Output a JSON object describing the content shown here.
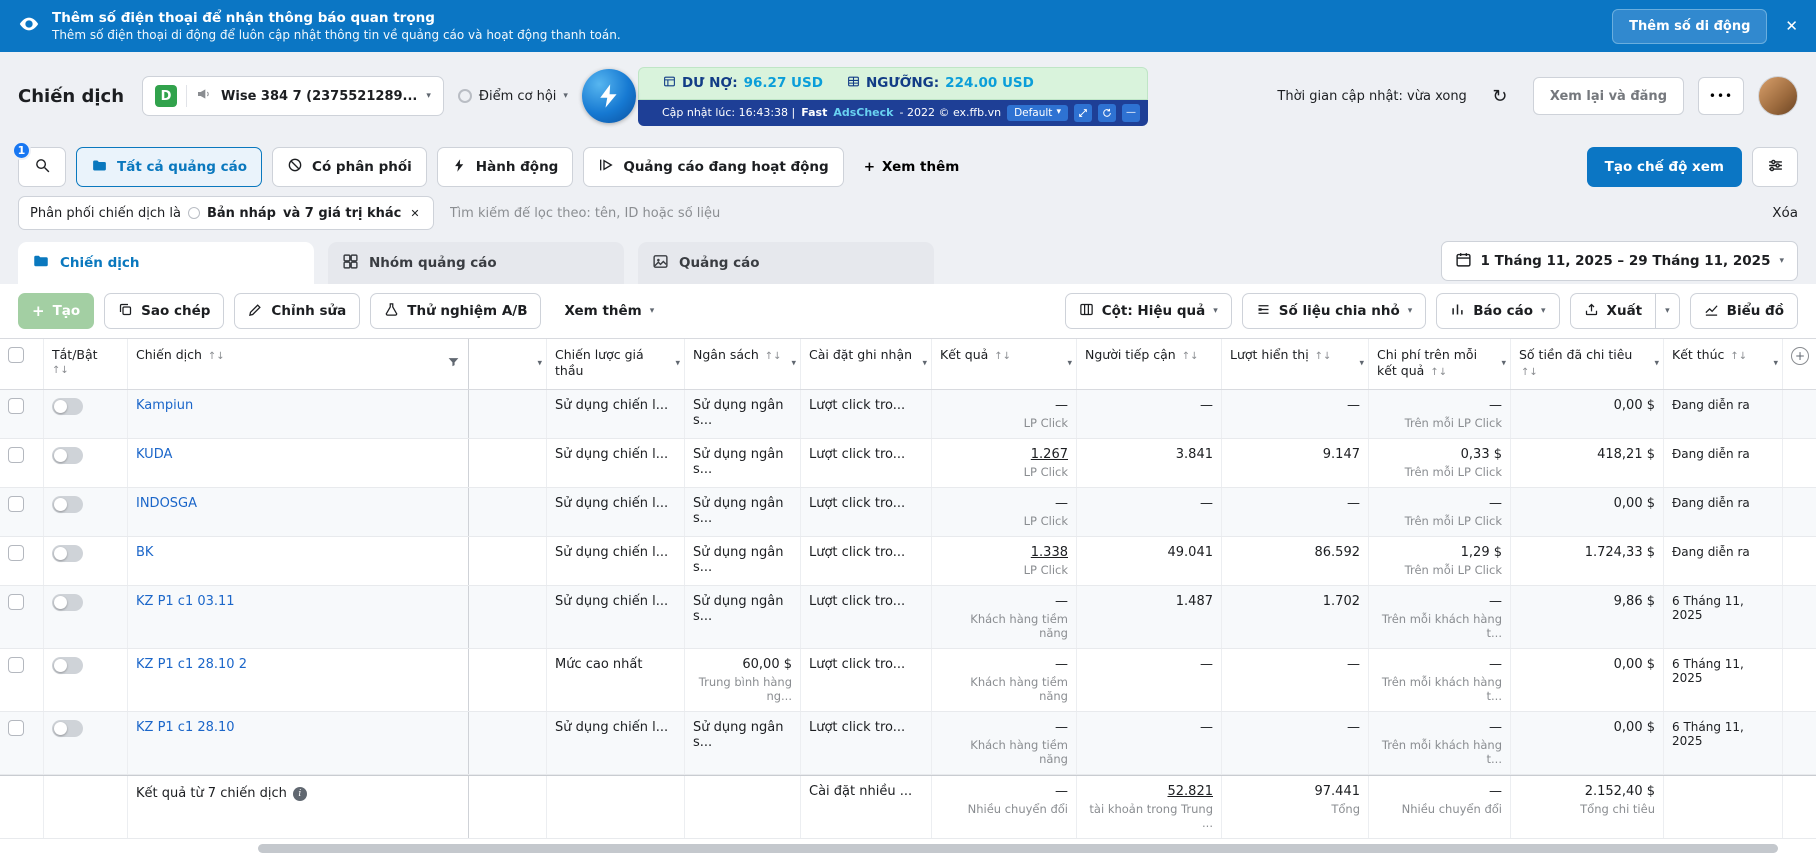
{
  "icons": {
    "sort": "↑↓",
    "caret": "▾",
    "close": "✕",
    "plus": "+",
    "more_dots": "•••",
    "refresh": "↻",
    "minimize": "—",
    "info": "i",
    "add": "+"
  },
  "banner": {
    "title": "Thêm số điện thoại để nhận thông báo quan trọng",
    "subtitle": "Thêm số điện thoại di động để luôn cập nhật thông tin về quảng cáo và hoạt động thanh toán.",
    "cta": "Thêm số di động"
  },
  "header": {
    "page_title": "Chiến dịch",
    "account_badge": "D",
    "account_name": "Wise 384 7 (2375521289...",
    "opportunity_label": "Điểm cơ hội",
    "balance": {
      "debt_label": "DƯ NỢ:",
      "debt_value": "96.27 USD",
      "threshold_label": "NGƯỠNG:",
      "threshold_value": "224.00 USD"
    },
    "adscheck": {
      "updated": "Cập nhật lúc: 16:43:38 |",
      "brand": "Fast",
      "product": "AdsCheck",
      "suffix": "- 2022 © ex.ffb.vn",
      "preset": "Default"
    },
    "refresh_status": "Thời gian cập nhật: vừa xong",
    "review_button": "Xem lại và đăng"
  },
  "filter_bar": {
    "search_badge": "1",
    "views": [
      "Tất cả quảng cáo",
      "Có phân phối",
      "Hành động",
      "Quảng cáo đang hoạt động"
    ],
    "more_label": "Xem thêm",
    "create_view_button": "Tạo chế độ xem"
  },
  "filter_chip": {
    "prefix": "Phân phối chiến dịch là",
    "value": "Bản nháp",
    "extra": "và 7 giá trị khác",
    "search_placeholder": "Tìm kiếm để lọc theo: tên, ID hoặc số liệu",
    "clear_label": "Xóa"
  },
  "tabs": {
    "campaigns": "Chiến dịch",
    "ad_sets": "Nhóm quảng cáo",
    "ads": "Quảng cáo",
    "date_range": "1 Tháng 11, 2025 – 29 Tháng 11, 2025"
  },
  "toolbar": {
    "create": "Tạo",
    "duplicate": "Sao chép",
    "edit": "Chỉnh sửa",
    "ab_test": "Thử nghiệm A/B",
    "more": "Xem thêm",
    "columns": "Cột: Hiệu quả",
    "breakdown": "Số liệu chia nhỏ",
    "reports": "Báo cáo",
    "export": "Xuất",
    "charts": "Biểu đồ"
  },
  "table": {
    "headers": {
      "toggle": "Tắt/Bật",
      "campaign": "Chiến dịch",
      "bid_strategy": "Chiến lược giá thầu",
      "budget": "Ngân sách",
      "attribution": "Cài đặt ghi nhận",
      "results": "Kết quả",
      "reach": "Người tiếp cận",
      "impressions": "Lượt hiển thị",
      "cost_per_result": "Chi phí trên mỗi kết quả",
      "amount_spent": "Số tiền đã chi tiêu",
      "ends": "Kết thúc"
    },
    "rows": [
      {
        "name": "Kampiun",
        "bid": "Sử dụng chiến l...",
        "budget": "Sử dụng ngân s...",
        "budget_sub": "",
        "attribution": "Lượt click tro...",
        "result": "—",
        "result_sub": "LP Click",
        "result_link": false,
        "reach": "—",
        "impressions": "—",
        "cost": "—",
        "cost_sub": "Trên mỗi LP Click",
        "spent": "0,00 $",
        "end": "Đang diễn ra"
      },
      {
        "name": "KUDA",
        "bid": "Sử dụng chiến l...",
        "budget": "Sử dụng ngân s...",
        "budget_sub": "",
        "attribution": "Lượt click tro...",
        "result": "1.267",
        "result_sub": "LP Click",
        "result_link": true,
        "reach": "3.841",
        "impressions": "9.147",
        "cost": "0,33 $",
        "cost_sub": "Trên mỗi LP Click",
        "spent": "418,21 $",
        "end": "Đang diễn ra"
      },
      {
        "name": "INDOSGA",
        "bid": "Sử dụng chiến l...",
        "budget": "Sử dụng ngân s...",
        "budget_sub": "",
        "attribution": "Lượt click tro...",
        "result": "—",
        "result_sub": "LP Click",
        "result_link": false,
        "reach": "—",
        "impressions": "—",
        "cost": "—",
        "cost_sub": "Trên mỗi LP Click",
        "spent": "0,00 $",
        "end": "Đang diễn ra"
      },
      {
        "name": "BK",
        "bid": "Sử dụng chiến l...",
        "budget": "Sử dụng ngân s...",
        "budget_sub": "",
        "attribution": "Lượt click tro...",
        "result": "1.338",
        "result_sub": "LP Click",
        "result_link": true,
        "reach": "49.041",
        "impressions": "86.592",
        "cost": "1,29 $",
        "cost_sub": "Trên mỗi LP Click",
        "spent": "1.724,33 $",
        "end": "Đang diễn ra"
      },
      {
        "name": "KZ P1 c1 03.11",
        "bid": "Sử dụng chiến l...",
        "budget": "Sử dụng ngân s...",
        "budget_sub": "",
        "attribution": "Lượt click tro...",
        "result": "—",
        "result_sub": "Khách hàng tiềm năng",
        "result_link": false,
        "reach": "1.487",
        "impressions": "1.702",
        "cost": "—",
        "cost_sub": "Trên mỗi khách hàng t...",
        "spent": "9,86 $",
        "end": "6 Tháng 11, 2025"
      },
      {
        "name": "KZ P1 c1 28.10 2",
        "bid": "Mức cao nhất",
        "budget": "60,00 $",
        "budget_sub": "Trung bình hàng ng...",
        "attribution": "Lượt click tro...",
        "result": "—",
        "result_sub": "Khách hàng tiềm năng",
        "result_link": false,
        "reach": "—",
        "impressions": "—",
        "cost": "—",
        "cost_sub": "Trên mỗi khách hàng t...",
        "spent": "0,00 $",
        "end": "6 Tháng 11, 2025"
      },
      {
        "name": "KZ P1 c1 28.10",
        "bid": "Sử dụng chiến l...",
        "budget": "Sử dụng ngân s...",
        "budget_sub": "",
        "attribution": "Lượt click tro...",
        "result": "—",
        "result_sub": "Khách hàng tiềm năng",
        "result_link": false,
        "reach": "—",
        "impressions": "—",
        "cost": "—",
        "cost_sub": "Trên mỗi khách hàng t...",
        "spent": "0,00 $",
        "end": "6 Tháng 11, 2025"
      }
    ],
    "footer": {
      "label": "Kết quả từ 7 chiến dịch",
      "attribution": "Cài đặt nhiều ...",
      "result": "—",
      "result_sub": "Nhiều chuyển đổi",
      "reach": "52.821",
      "reach_sub": "tài khoản trong Trung ...",
      "impressions": "97.441",
      "impressions_sub": "Tổng",
      "cost": "—",
      "cost_sub": "Nhiều chuyển đổi",
      "spent": "2.152,40 $",
      "spent_sub": "Tổng chi tiêu"
    }
  },
  "colors": {
    "brand_blue": "#0b76c4",
    "link_blue": "#1b66c9",
    "balance_green_bg": "#d9f3dc",
    "status_green": "#31a24c",
    "adscheck_navy": "#1e3f96"
  }
}
